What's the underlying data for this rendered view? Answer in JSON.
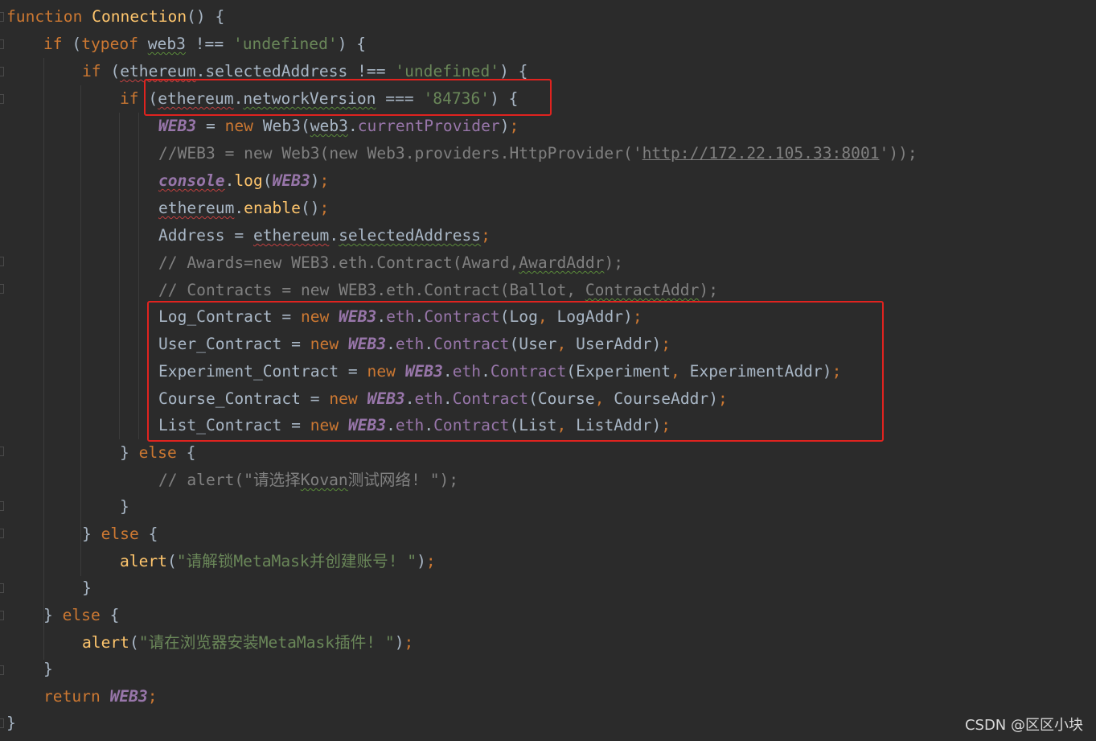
{
  "code": {
    "l1_kw": "function",
    "l1_fn": "Connection",
    "l1_rest": "() {",
    "l2_kw": "if",
    "l2_p1": " (",
    "l2_typeof": "typeof",
    "l2_sp": " ",
    "l2_var": "web3",
    "l2_op": " !== ",
    "l2_str": "'undefined'",
    "l2_end": ") {",
    "l3_kw": "if",
    "l3_p1": " (",
    "l3_obj": "ethereum",
    "l3_dot": ".",
    "l3_prop": "selectedAddress",
    "l3_op": " !== ",
    "l3_str": "'undefined'",
    "l3_end": ") {",
    "l4_kw": "if",
    "l4_p1": " (",
    "l4_obj": "ethereum",
    "l4_dot": ".",
    "l4_prop": "networkVersion",
    "l4_op": " === ",
    "l4_str": "'84736'",
    "l4_end": ") {",
    "l5_g": "WEB3",
    "l5_eq": " = ",
    "l5_new": "new",
    "l5_cls": " Web3(",
    "l5_arg1": "web3",
    "l5_dot": ".",
    "l5_arg2": "currentProvider",
    "l5_end": ")",
    "l5_semi": ";",
    "l6_c1": "//WEB3 = new Web3(new Web3.providers.HttpProvider('",
    "l6_url": "http://172.22.105.33:8001",
    "l6_c2": "'));",
    "l7_obj": "console",
    "l7_dot": ".",
    "l7_fn": "log",
    "l7_p": "(",
    "l7_g": "WEB3",
    "l7_end": ")",
    "l7_semi": ";",
    "l8_obj": "ethereum",
    "l8_dot": ".",
    "l8_fn": "enable",
    "l8_end": "()",
    "l8_semi": ";",
    "l9_var": "Address",
    "l9_eq": " = ",
    "l9_obj": "ethereum",
    "l9_dot": ".",
    "l9_prop": "selectedAddress",
    "l9_semi": ";",
    "l10_c": "// Awards=new WEB3.eth.Contract(Award,",
    "l10_sq": "AwardAddr",
    "l10_end": ");",
    "l11_c": "// Contracts = new WEB3.eth.Contract(Ballot, ",
    "l11_sq": "ContractAddr",
    "l11_end": ");",
    "l12_var": "Log_Contract",
    "l12_arg1": "Log",
    "l12_arg2": "LogAddr",
    "l13_var": "User_Contract",
    "l13_arg1": "User",
    "l13_arg2": "UserAddr",
    "l14_var": "Experiment_Contract",
    "l14_arg1": "Experiment",
    "l14_arg2": "ExperimentAddr",
    "l15_var": "Course_Contract",
    "l15_arg1": "Course",
    "l15_arg2": "CourseAddr",
    "l16_var": "List_Contract",
    "l16_arg1": "List",
    "l16_arg2": "ListAddr",
    "eq": " = ",
    "new": "new",
    "sp": " ",
    "web3g": "WEB3",
    "dot": ".",
    "eth": "eth",
    "contract": "Contract",
    "lp": "(",
    "comma": ", ",
    "rp": ")",
    "semi": ";",
    "l17_close": "} ",
    "l17_else": "else",
    "l17_brace": " {",
    "l18_c1": "// alert(\"请选择",
    "l18_sq": "Kovan",
    "l18_c2": "测试网络! \");",
    "l19": "}",
    "l20_close": "} ",
    "l20_else": "else",
    "l20_brace": " {",
    "l21_fn": "alert",
    "l21_p": "(",
    "l21_str": "\"请解锁MetaMask并创建账号! \"",
    "l21_end": ")",
    "l21_semi": ";",
    "l22": "}",
    "l23_close": "} ",
    "l23_else": "else",
    "l23_brace": " {",
    "l24_fn": "alert",
    "l24_p": "(",
    "l24_str": "\"请在浏览器安装MetaMask插件! \"",
    "l24_end": ")",
    "l24_semi": ";",
    "l25": "}",
    "l26_kw": "return",
    "l26_g": "WEB3",
    "l26_semi": ";",
    "l27": "}"
  },
  "watermark": "CSDN @区区小块",
  "colors": {
    "background": "#2b2b2b",
    "keyword": "#cc7832",
    "function": "#ffc66d",
    "string": "#6a8759",
    "comment": "#808080",
    "global": "#9876aa",
    "plain": "#a9b7c6",
    "highlight_box": "#e0231f"
  }
}
